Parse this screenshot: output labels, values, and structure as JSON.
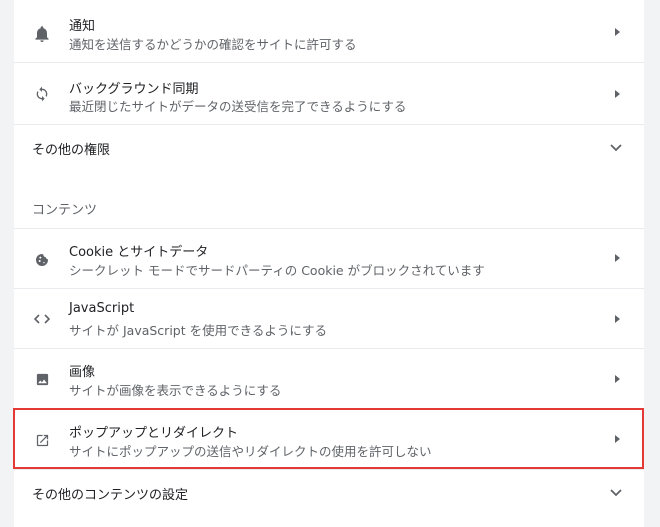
{
  "rows": [
    {
      "title": "通知",
      "subtitle": "通知を送信するかどうかの確認をサイトに許可する",
      "icon": "bell-icon"
    },
    {
      "title": "バックグラウンド同期",
      "subtitle": "最近閉じたサイトがデータの送受信を完了できるようにする",
      "icon": "sync-icon"
    }
  ],
  "other_permissions_label": "その他の権限",
  "content_section_title": "コンテンツ",
  "content_rows": [
    {
      "title": "Cookie とサイトデータ",
      "subtitle": "シークレット モードでサードパーティの Cookie がブロックされています",
      "icon": "cookie-icon"
    },
    {
      "title": "JavaScript",
      "subtitle": "サイトが JavaScript を使用できるようにする",
      "icon": "code-icon"
    },
    {
      "title": "画像",
      "subtitle": "サイトが画像を表示できるようにする",
      "icon": "image-icon"
    },
    {
      "title": "ポップアップとリダイレクト",
      "subtitle": "サイトにポップアップの送信やリダイレクトの使用を許可しない",
      "icon": "open-in-new-icon"
    }
  ],
  "other_content_label": "その他のコンテンツの設定",
  "colors": {
    "highlight": "#e53935",
    "background": "#f1f3f4",
    "secondary_text": "#5f6368"
  }
}
